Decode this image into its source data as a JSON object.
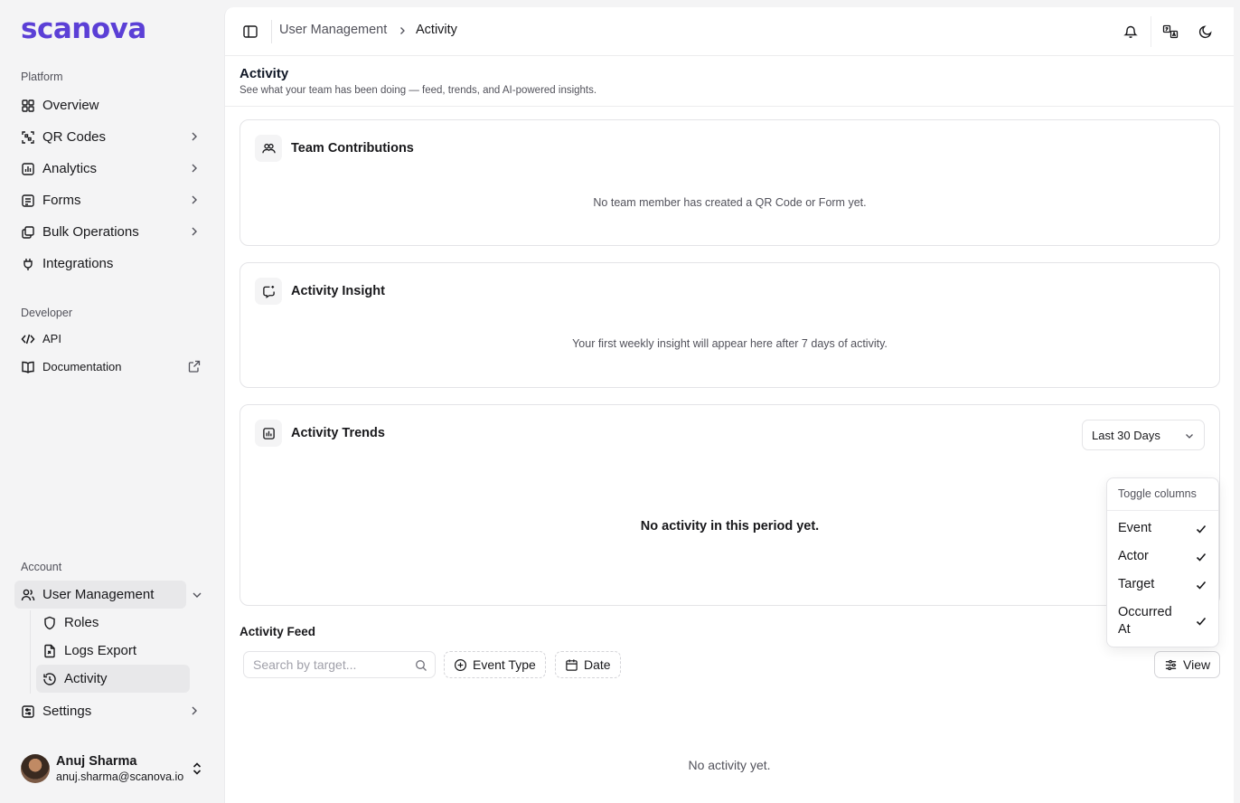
{
  "brand": {
    "logo": "scanova",
    "accent": "#5b3fd6"
  },
  "sidebar": {
    "platform_label": "Platform",
    "platform_items": [
      {
        "label": "Overview",
        "icon": "grid-icon"
      },
      {
        "label": "QR Codes",
        "icon": "scan-icon"
      },
      {
        "label": "Analytics",
        "icon": "chart-icon"
      },
      {
        "label": "Forms",
        "icon": "forms-icon"
      },
      {
        "label": "Bulk Operations",
        "icon": "boxes-icon"
      },
      {
        "label": "Integrations",
        "icon": "plug-icon"
      }
    ],
    "developer_label": "Developer",
    "developer_items": [
      {
        "label": "API",
        "icon": "code-icon"
      },
      {
        "label": "Documentation",
        "icon": "book-icon"
      }
    ],
    "account_label": "Account",
    "account_items": {
      "user_management": "User Management",
      "roles": "Roles",
      "logs_export": "Logs Export",
      "activity": "Activity",
      "settings": "Settings"
    },
    "user": {
      "name": "Anuj Sharma",
      "email": "anuj.sharma@scanova.io"
    }
  },
  "header": {
    "breadcrumb": [
      "User Management",
      "Activity"
    ]
  },
  "page": {
    "title": "Activity",
    "subtitle": "See what your team has been doing — feed, trends, and AI-powered insights."
  },
  "cards": {
    "team": {
      "title": "Team Contributions",
      "empty": "No team member has created a QR Code or Form yet."
    },
    "insight": {
      "title": "Activity Insight",
      "empty": "Your first weekly insight will appear here after 7 days of activity."
    },
    "trends": {
      "title": "Activity Trends",
      "range": "Last 30 Days",
      "empty": "No activity in this period yet."
    }
  },
  "feed": {
    "title": "Activity Feed",
    "search_placeholder": "Search by target...",
    "filter_event": "Event Type",
    "filter_date": "Date",
    "view_label": "View",
    "empty": "No activity yet."
  },
  "columns_popover": {
    "heading": "Toggle columns",
    "items": [
      {
        "label": "Event",
        "checked": true
      },
      {
        "label": "Actor",
        "checked": true
      },
      {
        "label": "Target",
        "checked": true
      },
      {
        "label": "Occurred At",
        "checked": true
      }
    ]
  }
}
